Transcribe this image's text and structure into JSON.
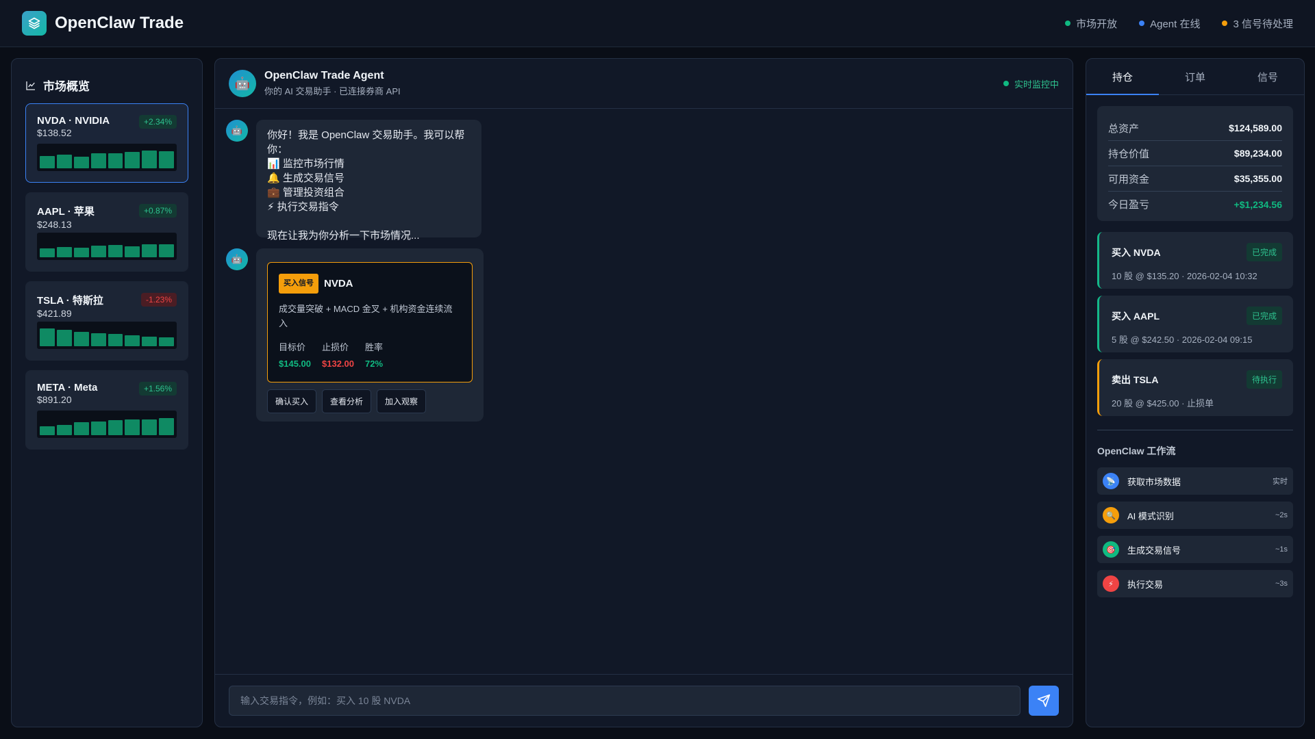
{
  "app": {
    "title": "OpenClaw Trade"
  },
  "header": {
    "statuses": [
      {
        "label": "市场开放",
        "color": "#10b981"
      },
      {
        "label": "Agent 在线",
        "color": "#3b82f6"
      },
      {
        "label": "3 信号待处理",
        "color": "#f59e0b"
      }
    ]
  },
  "market": {
    "title": "市场概览",
    "stocks": [
      {
        "name": "NVDA · NVIDIA",
        "price": "$138.52",
        "change": "+2.34%",
        "trend": "up",
        "bars": [
          0.55,
          0.62,
          0.52,
          0.68,
          0.7,
          0.74,
          0.82,
          0.78
        ]
      },
      {
        "name": "AAPL · 苹果",
        "price": "$248.13",
        "change": "+0.87%",
        "trend": "up",
        "bars": [
          0.42,
          0.48,
          0.45,
          0.52,
          0.55,
          0.5,
          0.6,
          0.58
        ]
      },
      {
        "name": "TSLA · 特斯拉",
        "price": "$421.89",
        "change": "-1.23%",
        "trend": "down",
        "bars": [
          0.82,
          0.75,
          0.65,
          0.6,
          0.55,
          0.5,
          0.45,
          0.4
        ]
      },
      {
        "name": "META · Meta",
        "price": "$891.20",
        "change": "+1.56%",
        "trend": "up",
        "bars": [
          0.42,
          0.46,
          0.58,
          0.62,
          0.68,
          0.72,
          0.72,
          0.78
        ]
      }
    ]
  },
  "chat": {
    "agent_name": "OpenClaw Trade Agent",
    "agent_sub": "你的 AI 交易助手 · 已连接券商 API",
    "live_status": "实时监控中",
    "greeting": {
      "line1": "你好！我是 OpenClaw 交易助手。我可以帮你：",
      "items": [
        "📊 监控市场行情",
        "🔔 生成交易信号",
        "💼 管理投资组合",
        "⚡ 执行交易指令"
      ],
      "closing": "现在让我为你分析一下市场情况..."
    },
    "signal": {
      "tag": "买入信号",
      "ticker": "NVDA",
      "desc": "成交量突破 + MACD 金叉 + 机构资金连续流入",
      "target_label": "目标价",
      "target_value": "$145.00",
      "stop_label": "止损价",
      "stop_value": "$132.00",
      "winrate_label": "胜率",
      "winrate_value": "72%"
    },
    "actions": [
      "确认买入",
      "查看分析",
      "加入观察"
    ],
    "input_placeholder": "输入交易指令，例如：买入 10 股 NVDA"
  },
  "right": {
    "tabs": [
      "持仓",
      "订单",
      "信号"
    ],
    "summary": [
      {
        "label": "总资产",
        "value": "$124,589.00",
        "color": "#f1f5f9"
      },
      {
        "label": "持仓价值",
        "value": "$89,234.00",
        "color": "#f1f5f9"
      },
      {
        "label": "可用资金",
        "value": "$35,355.00",
        "color": "#f1f5f9"
      },
      {
        "label": "今日盈亏",
        "value": "+$1,234.56",
        "color": "#10b981"
      }
    ],
    "orders": [
      {
        "title": "买入 NVDA",
        "detail": "10 股 @ $135.20 · 2026-02-04 10:32",
        "status": "已完成",
        "accent": "green"
      },
      {
        "title": "买入 AAPL",
        "detail": "5 股 @ $242.50 · 2026-02-04 09:15",
        "status": "已完成",
        "accent": "green"
      },
      {
        "title": "卖出 TSLA",
        "detail": "20 股 @ $425.00 · 止损单",
        "status": "待执行",
        "accent": "orange"
      }
    ],
    "workflow_title": "OpenClaw 工作流",
    "workflow": [
      {
        "label": "获取市场数据",
        "time": "实时",
        "icon": "satellite-icon",
        "glyph": "📡",
        "color": "#3b82f6"
      },
      {
        "label": "AI 模式识别",
        "time": "~2s",
        "icon": "magnifier-icon",
        "glyph": "🔍",
        "color": "#f59e0b"
      },
      {
        "label": "生成交易信号",
        "time": "~1s",
        "icon": "target-icon",
        "glyph": "🎯",
        "color": "#10b981"
      },
      {
        "label": "执行交易",
        "time": "~3s",
        "icon": "lightning-icon",
        "glyph": "⚡",
        "color": "#ef4444"
      }
    ]
  }
}
